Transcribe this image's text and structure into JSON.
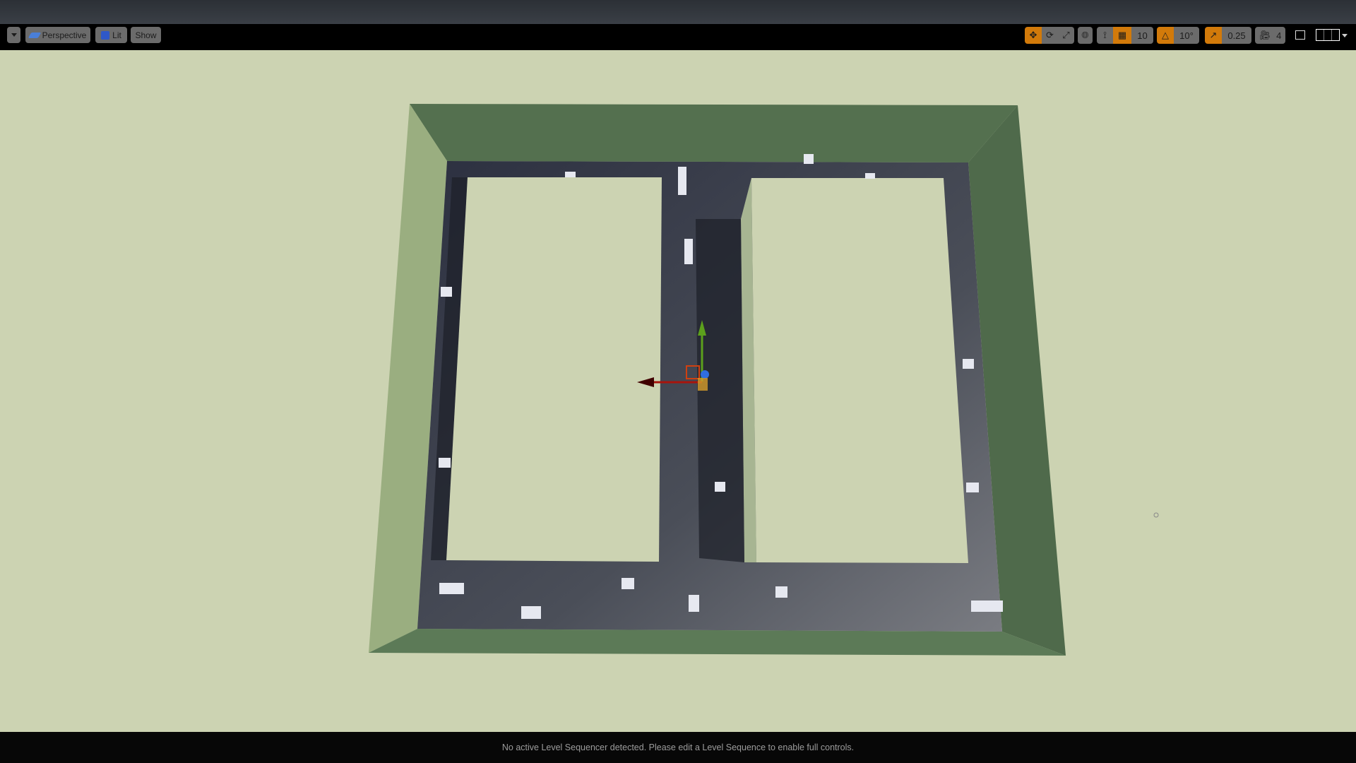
{
  "toolbar": {
    "left": {
      "menu_icon": "chevron-down-icon",
      "perspective_label": "Perspective",
      "lit_label": "Lit",
      "show_label": "Show"
    },
    "right": {
      "grid_snap_value": "10",
      "rotation_snap_value": "10°",
      "scale_snap_value": "0.25",
      "camera_speed_value": "4"
    }
  },
  "status": {
    "message": "No active Level Sequencer detected. Please edit a Level Sequence to enable full controls."
  },
  "colors": {
    "accent": "#d27a0a",
    "ground": "#ccd3b2",
    "wall": "#587454",
    "floor": "#3a3e48"
  }
}
